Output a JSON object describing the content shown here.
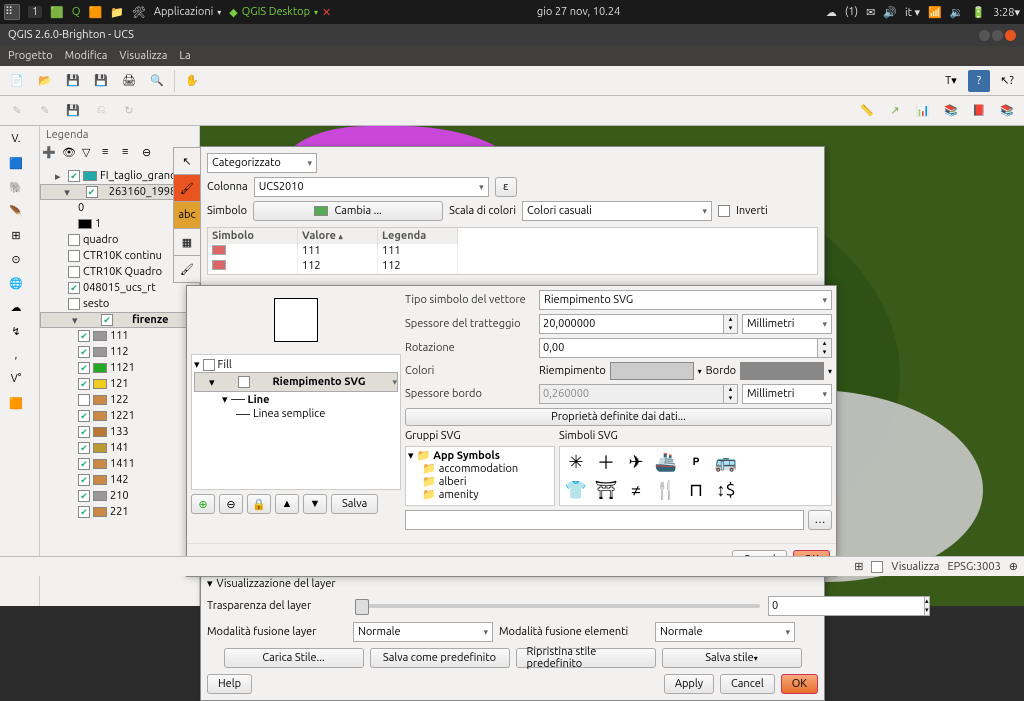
{
  "topbar": {
    "workspace": "1",
    "app_menu": "Applicazioni",
    "qgis_menu": "QGIS Desktop",
    "date": "gio 27 nov, 10.24",
    "notif": "(1)",
    "lang": "it",
    "time": "3:28"
  },
  "window": {
    "title": "QGIS 2.6.0-Brighton - UCS"
  },
  "menubar": [
    "Progetto",
    "Modifica",
    "Visualizza",
    "La"
  ],
  "legend": {
    "title": "Legenda",
    "items": [
      {
        "ind": 1,
        "label": "FI_taglio_grand",
        "chk": true,
        "tgl": "▸",
        "sw": "#2aa",
        "cb": true
      },
      {
        "ind": 1,
        "label": "263160_1998",
        "chk": true,
        "tgl": "▾",
        "sw": null,
        "cb": true,
        "sel": true
      },
      {
        "ind": 2,
        "label": "0",
        "chk": false,
        "sw": null,
        "cb": false
      },
      {
        "ind": 2,
        "label": "1",
        "chk": false,
        "sw": "#000",
        "cb": false
      },
      {
        "ind": 1,
        "label": "quadro",
        "chk": false,
        "cb": true
      },
      {
        "ind": 1,
        "label": "CTR10K continu",
        "chk": false,
        "cb": true
      },
      {
        "ind": 1,
        "label": "CTR10K Quadro",
        "chk": false,
        "cb": true
      },
      {
        "ind": 1,
        "label": "048015_ucs_rt",
        "chk": true,
        "cb": true
      },
      {
        "ind": 1,
        "label": "sesto",
        "chk": false,
        "cb": true
      },
      {
        "ind": 1,
        "label": "firenze",
        "chk": true,
        "tgl": "▾",
        "cb": true,
        "sel": true,
        "bold": true
      },
      {
        "ind": 2,
        "label": "111",
        "chk": true,
        "sw": "#999",
        "cb": true
      },
      {
        "ind": 2,
        "label": "112",
        "chk": true,
        "sw": "#999",
        "cb": true
      },
      {
        "ind": 2,
        "label": "1121",
        "chk": true,
        "sw": "#2a2",
        "cb": true
      },
      {
        "ind": 2,
        "label": "121",
        "chk": true,
        "sw": "#ec2",
        "cb": true
      },
      {
        "ind": 2,
        "label": "122",
        "chk": false,
        "sw": "#c84",
        "cb": true
      },
      {
        "ind": 2,
        "label": "1221",
        "chk": true,
        "sw": "#c84",
        "cb": true
      },
      {
        "ind": 2,
        "label": "133",
        "chk": true,
        "sw": "#b73",
        "cb": true
      },
      {
        "ind": 2,
        "label": "141",
        "chk": true,
        "sw": "#b93",
        "cb": true
      },
      {
        "ind": 2,
        "label": "1411",
        "chk": true,
        "sw": "#c84",
        "cb": true
      },
      {
        "ind": 2,
        "label": "142",
        "chk": true,
        "sw": "#c84",
        "cb": true
      },
      {
        "ind": 2,
        "label": "210",
        "chk": true,
        "sw": "#999",
        "cb": true
      },
      {
        "ind": 2,
        "label": "221",
        "chk": true,
        "sw": "#c84",
        "cb": true
      }
    ]
  },
  "style": {
    "method": "Categorizzato",
    "col_label": "Colonna",
    "column": "UCS2010",
    "sym_label": "Simbolo",
    "sym_btn": "Cambia ...",
    "ramp_label": "Scala di colori",
    "ramp": "Colori casuali",
    "invert": "Inverti",
    "headers": [
      "Simbolo",
      "Valore",
      "Legenda"
    ],
    "rows": [
      {
        "sw": "#d66",
        "v": "111",
        "l": "111"
      },
      {
        "sw": "#d66",
        "v": "112",
        "l": "112"
      }
    ],
    "vis_title": "Visualizzazione del layer",
    "trans": "Trasparenza del layer",
    "trans_val": "0",
    "blend_l": "Modalità fusione layer",
    "blend_l_v": "Normale",
    "blend_e": "Modalità fusione elementi",
    "blend_e_v": "Normale",
    "load": "Carica Stile...",
    "savedef": "Salva come predefinito",
    "restore": "Ripristina stile predefinito",
    "save": "Salva stile",
    "help": "Help",
    "apply": "Apply",
    "cancel": "Cancel",
    "ok": "OK"
  },
  "inner": {
    "tree": [
      "Fill",
      "Riempimento SVG",
      "Line",
      "Linea semplice"
    ],
    "type_l": "Tipo simbolo del vettore",
    "type_v": "Riempimento SVG",
    "hatch_l": "Spessore del tratteggio",
    "hatch_v": "20,000000",
    "unit": "Millimetri",
    "rot_l": "Rotazione",
    "rot_v": "0,00",
    "color_l": "Colori",
    "fill_l": "Riempimento",
    "stroke_l": "Bordo",
    "bw_l": "Spessore bordo",
    "bw_v": "0,260000",
    "datadef": "Proprietà definite dai dati...",
    "grp": "Gruppi SVG",
    "sym": "Simboli SVG",
    "groups": [
      "App Symbols",
      "accommodation",
      "alberi",
      "amenity"
    ],
    "salva": "Salva",
    "cancel": "Cancel",
    "ok": "OK"
  },
  "status": {
    "render": "Visualizza",
    "epsg": "EPSG:3003"
  }
}
